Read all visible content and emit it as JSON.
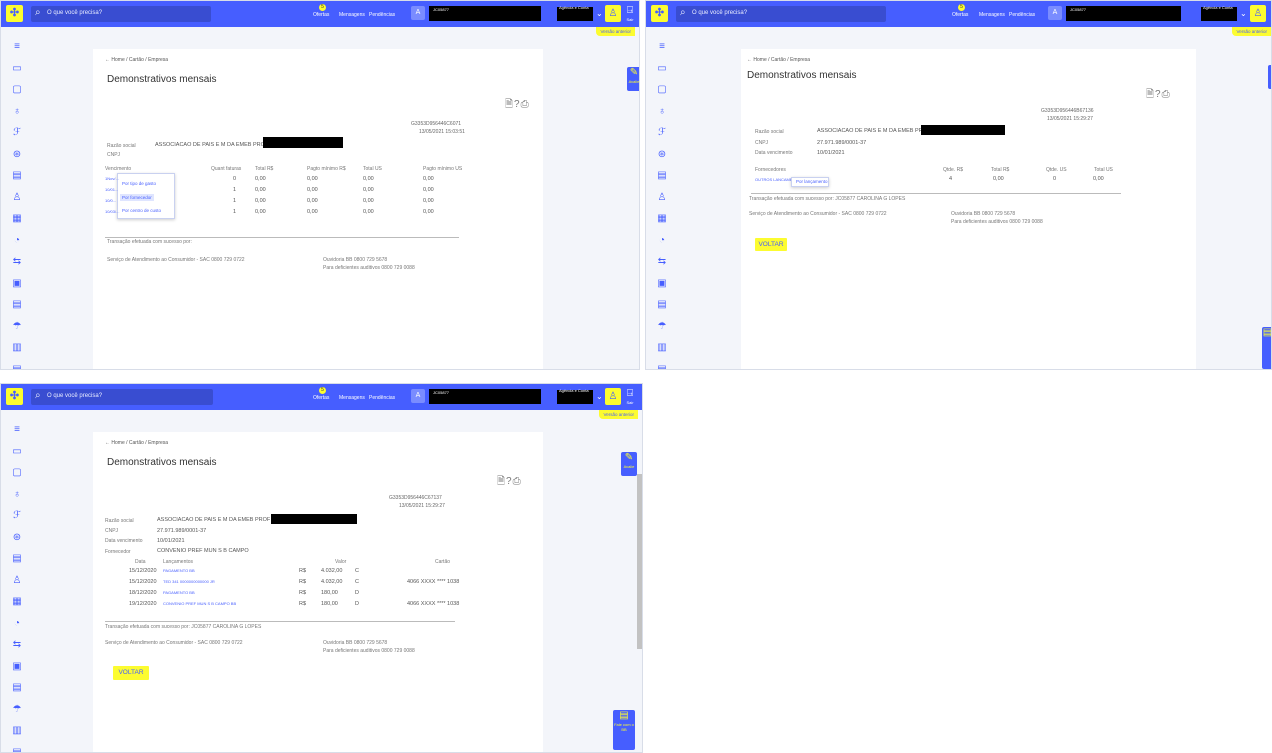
{
  "header": {
    "search_placeholder": "O que você precisa?",
    "ofertas": "Ofertas",
    "ofertas_badge": "5",
    "mensagens": "Mensagens",
    "pendencias": "Pendências",
    "avatar_letter": "A",
    "user_id": "JC05877",
    "agencia": "Agência e Conta",
    "sair": "Sair",
    "versao_anterior": "Versão anterior"
  },
  "sidebar_icons": [
    "menu-icon",
    "account-icon",
    "card-icon",
    "money-bag-icon",
    "dollar-icon",
    "coins-icon",
    "invoice-icon",
    "bank-icon",
    "savings-icon",
    "investment-icon",
    "transfer-icon",
    "calculator-icon",
    "document-icon",
    "umbrella-icon",
    "barcode-icon",
    "receipt-icon",
    "money-icon"
  ],
  "page": {
    "breadcrumb": "Home / Cartão / Empresa",
    "title": "Demonstrativos mensais",
    "voltar": "VOLTAR",
    "avalie": "Avalie",
    "fale_com_bb": "Fale com o BB"
  },
  "panel1": {
    "doc_id": "G3353D956446C6071",
    "timestamp": "13/05/2021 15:03:51",
    "razao_social_label": "Razão social",
    "razao_social": "ASSOCIACAO DE PAIS E M DA EMEB PROF",
    "cnpj_label": "CNPJ",
    "columns": [
      "Vencimento",
      "Quant faturas",
      "Total R$",
      "Pagto mínimo R$",
      "Total US",
      "Pagto mínimo US"
    ],
    "rows": [
      {
        "venc": "1Nov/...",
        "qt": "0",
        "total": "0,00",
        "pmin": "0,00",
        "tus": "0,00",
        "pus": "0,00"
      },
      {
        "venc": "10/01...",
        "qt": "1",
        "total": "0,00",
        "pmin": "0,00",
        "tus": "0,00",
        "pus": "0,00"
      },
      {
        "venc": "10/0...",
        "qt": "1",
        "total": "0,00",
        "pmin": "0,00",
        "tus": "0,00",
        "pus": "0,00"
      },
      {
        "venc": "10/03/...",
        "qt": "1",
        "total": "0,00",
        "pmin": "0,00",
        "tus": "0,00",
        "pus": "0,00"
      }
    ],
    "menu": [
      "Por tipo de gasto",
      "Por fornecedor",
      "Por centro de custo"
    ],
    "success": "Transação efetuada com sucesso por:",
    "sac": "Serviço de Atendimento ao Consumidor - SAC 0800 729 0722",
    "ouvidoria": "Ouvidoria BB 0800 729 5678",
    "deficientes": "Para deficientes auditivos 0800 729 0088"
  },
  "panel2": {
    "doc_id": "G3353D956446B67136",
    "timestamp": "13/05/2021 15:29:27",
    "razao_social_label": "Razão social",
    "razao_social": "ASSOCIACAO DE PAIS E M DA EMEB PROF",
    "cnpj_label": "CNPJ",
    "cnpj": "27.971.989/0001-37",
    "venc_label": "Data vencimento",
    "venc": "10/01/2021",
    "forn_label": "Fornecedores",
    "columns": [
      "Qtde. R$",
      "Total R$",
      "Qtde. US",
      "Total US"
    ],
    "row": {
      "forn": "OUTROS LANCAMENT...",
      "qr": "4",
      "tr": "0,00",
      "qu": "0",
      "tu": "0,00"
    },
    "tooltip": "Por lançamento",
    "success": "Transação efetuada com sucesso por: JC05877 CAROLINA G LOPES",
    "sac": "Serviço de Atendimento ao Consumidor - SAC 0800 729 0722",
    "ouvidoria": "Ouvidoria BB 0800 729 5678",
    "deficientes": "Para deficientes auditivos 0800 729 0088"
  },
  "panel3": {
    "doc_id": "G3353D956446C67137",
    "timestamp": "13/05/2021 15:29:27",
    "razao_social_label": "Razão social",
    "razao_social": "ASSOCIACAO DE PAIS E M DA EMEB PROF",
    "cnpj_label": "CNPJ",
    "cnpj": "27.971.989/0001-37",
    "venc_label": "Data vencimento",
    "venc": "10/01/2021",
    "forn_label": "Fornecedor",
    "forn": "CONVENIO PREF MUN S B CAMPO",
    "columns": [
      "Data",
      "Lançamentos",
      "Valor",
      "Cartão"
    ],
    "rows": [
      {
        "data": "15/12/2020",
        "lanc": "PAGAMENTO BB",
        "moeda": "R$",
        "valor": "4.032,00",
        "dc": "C",
        "cartao": ""
      },
      {
        "data": "15/12/2020",
        "lanc": "TED 341 0000000000000 JR",
        "moeda": "R$",
        "valor": "4.032,00",
        "dc": "C",
        "cartao": "4066 XXXX **** 1038"
      },
      {
        "data": "18/12/2020",
        "lanc": "PAGAMENTO BB",
        "moeda": "R$",
        "valor": "180,00",
        "dc": "D",
        "cartao": ""
      },
      {
        "data": "19/12/2020",
        "lanc": "CONVENIO PREF MUN S B CAMPO BB",
        "moeda": "R$",
        "valor": "180,00",
        "dc": "D",
        "cartao": "4066 XXXX **** 1038"
      }
    ],
    "success": "Transação efetuada com sucesso por: JC05877 CAROLINA G LOPES",
    "sac": "Serviço de Atendimento ao Consumidor - SAC 0800 729 0722",
    "ouvidoria": "Ouvidoria BB 0800 729 5678",
    "deficientes": "Para deficientes auditivos 0800 729 0088"
  }
}
